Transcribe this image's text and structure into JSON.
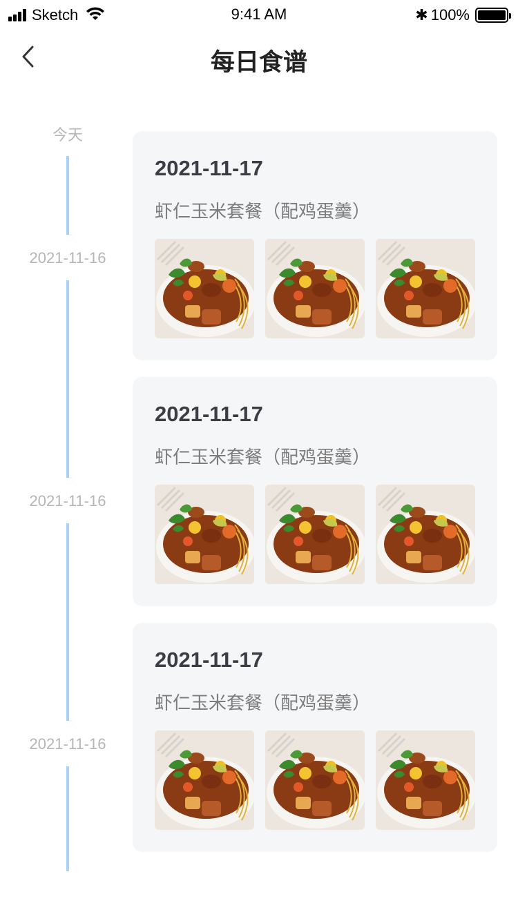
{
  "status_bar": {
    "carrier": "Sketch",
    "time": "9:41 AM",
    "bluetooth_symbol": "✱",
    "battery_text": "100%",
    "battery_level": 1.0
  },
  "nav": {
    "title": "每日食谱",
    "back_icon": "chevron-left-icon"
  },
  "timeline": {
    "labels": [
      "今天",
      "2021-11-16",
      "2021-11-16",
      "2021-11-16"
    ],
    "line_color": "#a9d1f8"
  },
  "cards": [
    {
      "date": "2021-11-17",
      "description": "虾仁玉米套餐（配鸡蛋羹）",
      "photos": 3
    },
    {
      "date": "2021-11-17",
      "description": "虾仁玉米套餐（配鸡蛋羹）",
      "photos": 3
    },
    {
      "date": "2021-11-17",
      "description": "虾仁玉米套餐（配鸡蛋羹）",
      "photos": 3
    }
  ]
}
